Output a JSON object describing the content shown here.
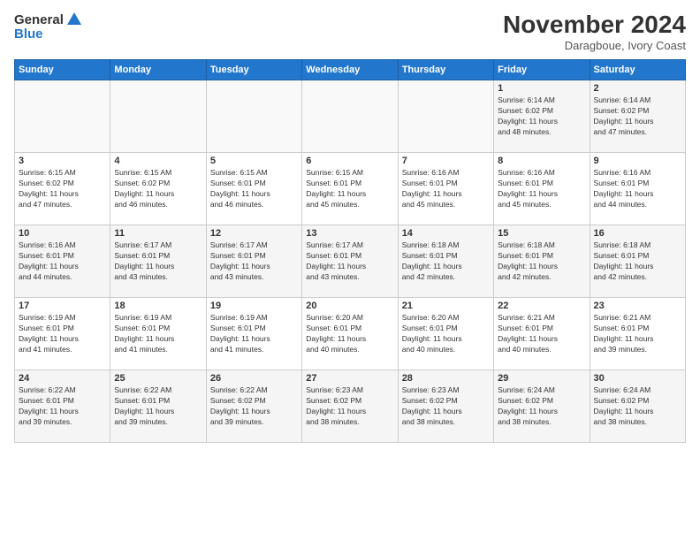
{
  "header": {
    "logo_general": "General",
    "logo_blue": "Blue",
    "month_title": "November 2024",
    "location": "Daragboue, Ivory Coast"
  },
  "days_of_week": [
    "Sunday",
    "Monday",
    "Tuesday",
    "Wednesday",
    "Thursday",
    "Friday",
    "Saturday"
  ],
  "weeks": [
    [
      {
        "day": "",
        "detail": ""
      },
      {
        "day": "",
        "detail": ""
      },
      {
        "day": "",
        "detail": ""
      },
      {
        "day": "",
        "detail": ""
      },
      {
        "day": "",
        "detail": ""
      },
      {
        "day": "1",
        "detail": "Sunrise: 6:14 AM\nSunset: 6:02 PM\nDaylight: 11 hours\nand 48 minutes."
      },
      {
        "day": "2",
        "detail": "Sunrise: 6:14 AM\nSunset: 6:02 PM\nDaylight: 11 hours\nand 47 minutes."
      }
    ],
    [
      {
        "day": "3",
        "detail": "Sunrise: 6:15 AM\nSunset: 6:02 PM\nDaylight: 11 hours\nand 47 minutes."
      },
      {
        "day": "4",
        "detail": "Sunrise: 6:15 AM\nSunset: 6:02 PM\nDaylight: 11 hours\nand 46 minutes."
      },
      {
        "day": "5",
        "detail": "Sunrise: 6:15 AM\nSunset: 6:01 PM\nDaylight: 11 hours\nand 46 minutes."
      },
      {
        "day": "6",
        "detail": "Sunrise: 6:15 AM\nSunset: 6:01 PM\nDaylight: 11 hours\nand 45 minutes."
      },
      {
        "day": "7",
        "detail": "Sunrise: 6:16 AM\nSunset: 6:01 PM\nDaylight: 11 hours\nand 45 minutes."
      },
      {
        "day": "8",
        "detail": "Sunrise: 6:16 AM\nSunset: 6:01 PM\nDaylight: 11 hours\nand 45 minutes."
      },
      {
        "day": "9",
        "detail": "Sunrise: 6:16 AM\nSunset: 6:01 PM\nDaylight: 11 hours\nand 44 minutes."
      }
    ],
    [
      {
        "day": "10",
        "detail": "Sunrise: 6:16 AM\nSunset: 6:01 PM\nDaylight: 11 hours\nand 44 minutes."
      },
      {
        "day": "11",
        "detail": "Sunrise: 6:17 AM\nSunset: 6:01 PM\nDaylight: 11 hours\nand 43 minutes."
      },
      {
        "day": "12",
        "detail": "Sunrise: 6:17 AM\nSunset: 6:01 PM\nDaylight: 11 hours\nand 43 minutes."
      },
      {
        "day": "13",
        "detail": "Sunrise: 6:17 AM\nSunset: 6:01 PM\nDaylight: 11 hours\nand 43 minutes."
      },
      {
        "day": "14",
        "detail": "Sunrise: 6:18 AM\nSunset: 6:01 PM\nDaylight: 11 hours\nand 42 minutes."
      },
      {
        "day": "15",
        "detail": "Sunrise: 6:18 AM\nSunset: 6:01 PM\nDaylight: 11 hours\nand 42 minutes."
      },
      {
        "day": "16",
        "detail": "Sunrise: 6:18 AM\nSunset: 6:01 PM\nDaylight: 11 hours\nand 42 minutes."
      }
    ],
    [
      {
        "day": "17",
        "detail": "Sunrise: 6:19 AM\nSunset: 6:01 PM\nDaylight: 11 hours\nand 41 minutes."
      },
      {
        "day": "18",
        "detail": "Sunrise: 6:19 AM\nSunset: 6:01 PM\nDaylight: 11 hours\nand 41 minutes."
      },
      {
        "day": "19",
        "detail": "Sunrise: 6:19 AM\nSunset: 6:01 PM\nDaylight: 11 hours\nand 41 minutes."
      },
      {
        "day": "20",
        "detail": "Sunrise: 6:20 AM\nSunset: 6:01 PM\nDaylight: 11 hours\nand 40 minutes."
      },
      {
        "day": "21",
        "detail": "Sunrise: 6:20 AM\nSunset: 6:01 PM\nDaylight: 11 hours\nand 40 minutes."
      },
      {
        "day": "22",
        "detail": "Sunrise: 6:21 AM\nSunset: 6:01 PM\nDaylight: 11 hours\nand 40 minutes."
      },
      {
        "day": "23",
        "detail": "Sunrise: 6:21 AM\nSunset: 6:01 PM\nDaylight: 11 hours\nand 39 minutes."
      }
    ],
    [
      {
        "day": "24",
        "detail": "Sunrise: 6:22 AM\nSunset: 6:01 PM\nDaylight: 11 hours\nand 39 minutes."
      },
      {
        "day": "25",
        "detail": "Sunrise: 6:22 AM\nSunset: 6:01 PM\nDaylight: 11 hours\nand 39 minutes."
      },
      {
        "day": "26",
        "detail": "Sunrise: 6:22 AM\nSunset: 6:02 PM\nDaylight: 11 hours\nand 39 minutes."
      },
      {
        "day": "27",
        "detail": "Sunrise: 6:23 AM\nSunset: 6:02 PM\nDaylight: 11 hours\nand 38 minutes."
      },
      {
        "day": "28",
        "detail": "Sunrise: 6:23 AM\nSunset: 6:02 PM\nDaylight: 11 hours\nand 38 minutes."
      },
      {
        "day": "29",
        "detail": "Sunrise: 6:24 AM\nSunset: 6:02 PM\nDaylight: 11 hours\nand 38 minutes."
      },
      {
        "day": "30",
        "detail": "Sunrise: 6:24 AM\nSunset: 6:02 PM\nDaylight: 11 hours\nand 38 minutes."
      }
    ]
  ]
}
